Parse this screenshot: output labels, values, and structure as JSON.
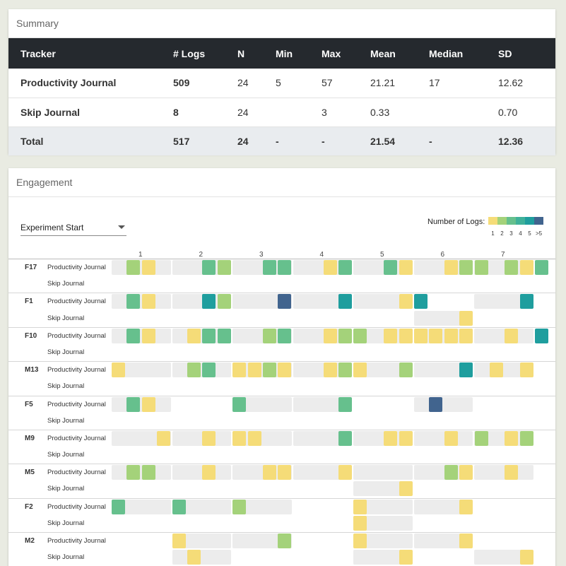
{
  "summary": {
    "title": "Summary",
    "headers": [
      "Tracker",
      "# Logs",
      "N",
      "Min",
      "Max",
      "Mean",
      "Median",
      "SD"
    ],
    "rows": [
      [
        "Productivity Journal",
        "509",
        "24",
        "5",
        "57",
        "21.21",
        "17",
        "12.62"
      ],
      [
        "Skip Journal",
        "8",
        "24",
        "",
        "3",
        "0.33",
        "",
        "0.70"
      ]
    ],
    "total": [
      "Total",
      "517",
      "24",
      "-",
      "-",
      "21.54",
      "-",
      "12.36"
    ]
  },
  "engagement": {
    "title": "Engagement",
    "select_value": "Experiment Start",
    "legend_title": "Number of Logs:",
    "legend_labels": [
      "1",
      "2",
      "3",
      "4",
      "5",
      ">5"
    ],
    "colors": [
      "#f5dc78",
      "#a4d27a",
      "#66c08d",
      "#3fb19a",
      "#1f9e9e",
      "#41648e"
    ],
    "days": [
      "1",
      "2",
      "3",
      "4",
      "5",
      "6",
      "7"
    ],
    "participants": [
      {
        "id": "F17",
        "pj": {
          "bg": [
            0,
            1,
            1,
            1,
            1,
            1,
            1
          ],
          "logs": [
            2,
            1,
            0,
            0,
            3,
            2,
            0,
            3,
            3,
            0,
            1,
            3,
            0,
            0,
            3,
            1,
            0,
            1,
            2,
            2,
            0,
            2,
            1,
            3
          ]
        },
        "sj": {
          "bg": [
            0,
            0,
            0,
            0,
            0,
            0,
            0
          ],
          "logs": []
        }
      },
      {
        "id": "F1",
        "pj": {
          "bg": [
            1,
            0,
            1,
            1,
            0,
            1,
            0
          ],
          "logs": [
            0,
            0,
            0,
            0,
            3,
            1,
            0,
            0,
            0,
            0,
            0,
            0,
            0,
            5,
            6,
            0,
            0,
            0,
            0,
            0,
            0,
            0,
            0,
            0,
            0,
            0,
            0,
            0,
            0,
            0,
            0,
            0,
            0,
            0,
            0,
            0,
            0,
            0,
            0,
            0,
            0,
            0,
            0,
            0,
            0,
            0,
            0,
            0,
            0,
            0,
            0,
            0,
            0,
            0,
            0,
            0,
            0,
            0,
            0,
            0
          ]
        },
        "sj": {
          "bg": [
            0,
            0,
            0,
            0,
            0,
            1,
            0
          ],
          "logs": []
        }
      },
      {
        "id": "F10",
        "pj": {
          "bg": [
            1,
            1,
            1,
            1,
            1,
            1,
            1
          ],
          "logs": []
        },
        "sj": {
          "bg": [
            0,
            0,
            0,
            0,
            0,
            0,
            0
          ],
          "logs": []
        }
      }
    ]
  },
  "rows": [
    {
      "pid": "F17",
      "tracker": "Productivity Journal",
      "bg": [
        1,
        1,
        1,
        1,
        1,
        1,
        1
      ],
      "cells": [
        [
          1,
          2
        ],
        [
          2,
          1
        ],
        [
          6,
          3
        ],
        [
          7,
          2
        ],
        [
          10,
          3
        ],
        [
          11,
          3
        ],
        [
          14,
          1
        ],
        [
          15,
          3
        ],
        [
          18,
          3
        ],
        [
          19,
          1
        ],
        [
          22,
          1
        ],
        [
          23,
          2
        ],
        [
          24,
          2
        ],
        [
          26,
          2
        ],
        [
          27,
          1
        ],
        [
          28,
          3
        ]
      ]
    },
    {
      "pid": "",
      "tracker": "Skip Journal",
      "bg": [
        0,
        0,
        0,
        0,
        0,
        0,
        0
      ],
      "cells": []
    },
    {
      "pid": "F1",
      "tracker": "Productivity Journal",
      "bg": [
        1,
        1,
        1,
        1,
        1,
        0,
        1
      ],
      "cells": [
        [
          1,
          3
        ],
        [
          2,
          1
        ],
        [
          6,
          5
        ],
        [
          7,
          2
        ],
        [
          11,
          6
        ],
        [
          15,
          5
        ],
        [
          19,
          1
        ],
        [
          20,
          5
        ],
        [
          27,
          5
        ]
      ]
    },
    {
      "pid": "",
      "tracker": "Skip Journal",
      "bg": [
        0,
        0,
        0,
        0,
        0,
        1,
        0
      ],
      "cells": [
        [
          23,
          1
        ]
      ]
    },
    {
      "pid": "F10",
      "tracker": "Productivity Journal",
      "bg": [
        1,
        1,
        1,
        1,
        1,
        1,
        1
      ],
      "cells": [
        [
          1,
          3
        ],
        [
          2,
          1
        ],
        [
          5,
          1
        ],
        [
          6,
          3
        ],
        [
          7,
          3
        ],
        [
          10,
          2
        ],
        [
          11,
          3
        ],
        [
          14,
          1
        ],
        [
          15,
          2
        ],
        [
          16,
          2
        ],
        [
          18,
          1
        ],
        [
          19,
          1
        ],
        [
          20,
          1
        ],
        [
          21,
          1
        ],
        [
          22,
          1
        ],
        [
          23,
          1
        ],
        [
          26,
          1
        ],
        [
          28,
          5
        ]
      ]
    },
    {
      "pid": "",
      "tracker": "Skip Journal",
      "bg": [
        0,
        0,
        0,
        0,
        0,
        0,
        0
      ],
      "cells": []
    },
    {
      "pid": "M13",
      "tracker": "Productivity Journal",
      "bg": [
        1,
        1,
        1,
        1,
        1,
        1,
        1
      ],
      "cells": [
        [
          0,
          1
        ],
        [
          5,
          2
        ],
        [
          6,
          3
        ],
        [
          8,
          1
        ],
        [
          9,
          1
        ],
        [
          10,
          2
        ],
        [
          11,
          1
        ],
        [
          14,
          1
        ],
        [
          15,
          2
        ],
        [
          16,
          1
        ],
        [
          19,
          2
        ],
        [
          23,
          5
        ],
        [
          25,
          1
        ],
        [
          27,
          1
        ]
      ]
    },
    {
      "pid": "",
      "tracker": "Skip Journal",
      "bg": [
        0,
        0,
        0,
        0,
        0,
        0,
        0
      ],
      "cells": []
    },
    {
      "pid": "F5",
      "tracker": "Productivity Journal",
      "bg": [
        1,
        0,
        1,
        1,
        0,
        1,
        0
      ],
      "cells": [
        [
          1,
          3
        ],
        [
          2,
          1
        ],
        [
          8,
          3
        ],
        [
          15,
          3
        ],
        [
          21,
          6
        ]
      ]
    },
    {
      "pid": "",
      "tracker": "Skip Journal",
      "bg": [
        0,
        0,
        0,
        0,
        0,
        0,
        0
      ],
      "cells": []
    },
    {
      "pid": "M9",
      "tracker": "Productivity Journal",
      "bg": [
        1,
        1,
        1,
        1,
        1,
        1,
        1
      ],
      "cells": [
        [
          3,
          1
        ],
        [
          6,
          1
        ],
        [
          8,
          1
        ],
        [
          9,
          1
        ],
        [
          15,
          3
        ],
        [
          18,
          1
        ],
        [
          19,
          1
        ],
        [
          22,
          1
        ],
        [
          24,
          2
        ],
        [
          26,
          1
        ],
        [
          27,
          2
        ]
      ]
    },
    {
      "pid": "",
      "tracker": "Skip Journal",
      "bg": [
        0,
        0,
        0,
        0,
        0,
        0,
        0
      ],
      "cells": []
    },
    {
      "pid": "M5",
      "tracker": "Productivity Journal",
      "bg": [
        1,
        1,
        1,
        1,
        1,
        1,
        1
      ],
      "cells": [
        [
          1,
          2
        ],
        [
          2,
          2
        ],
        [
          6,
          1
        ],
        [
          10,
          1
        ],
        [
          11,
          1
        ],
        [
          15,
          1
        ],
        [
          22,
          2
        ],
        [
          23,
          1
        ],
        [
          26,
          1
        ]
      ]
    },
    {
      "pid": "",
      "tracker": "Skip Journal",
      "bg": [
        0,
        0,
        0,
        0,
        1,
        0,
        0
      ],
      "cells": [
        [
          19,
          1
        ]
      ]
    },
    {
      "pid": "F2",
      "tracker": "Productivity Journal",
      "bg": [
        1,
        1,
        1,
        0,
        1,
        1,
        0
      ],
      "cells": [
        [
          0,
          3
        ],
        [
          4,
          3
        ],
        [
          8,
          2
        ],
        [
          16,
          1
        ],
        [
          23,
          1
        ]
      ]
    },
    {
      "pid": "",
      "tracker": "Skip Journal",
      "bg": [
        0,
        0,
        0,
        0,
        1,
        0,
        0
      ],
      "cells": [
        [
          16,
          1
        ]
      ]
    },
    {
      "pid": "M2",
      "tracker": "Productivity Journal",
      "bg": [
        0,
        1,
        1,
        0,
        1,
        1,
        0
      ],
      "cells": [
        [
          4,
          1
        ],
        [
          11,
          2
        ],
        [
          16,
          1
        ],
        [
          23,
          1
        ]
      ]
    },
    {
      "pid": "",
      "tracker": "Skip Journal",
      "bg": [
        0,
        1,
        0,
        0,
        1,
        0,
        1
      ],
      "cells": [
        [
          5,
          1
        ],
        [
          19,
          1
        ],
        [
          27,
          1
        ]
      ]
    }
  ]
}
